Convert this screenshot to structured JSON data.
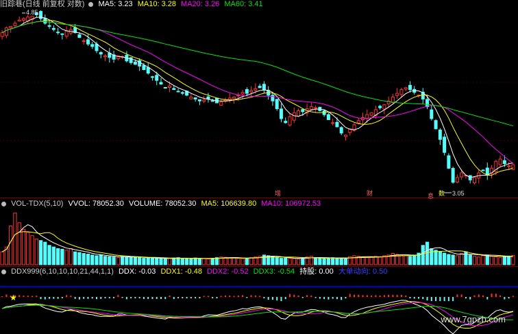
{
  "colors": {
    "up": "#ff3232",
    "down": "#54fcfc",
    "ma5": "#ffffff",
    "ma10": "#ffff00",
    "ma20": "#ff00ff",
    "ma60": "#00e600",
    "blue_line": "#0000ff",
    "separator": "#7a0000"
  },
  "price_panel": {
    "title": "旧踪巷(日线 前复权 对数)",
    "gear_icon": "gear-icon",
    "ma5": "MA5: 3.23",
    "ma10": "MA10: 3.28",
    "ma20": "MA20: 3.26",
    "ma60": "MA60: 3.41",
    "high_label": "4.85",
    "low_label": "3.05",
    "events": [
      {
        "text": "增",
        "color": "#ff6464"
      },
      {
        "text": "财",
        "color": "#ff6464"
      },
      {
        "text": "息",
        "color": "#ff6464"
      },
      {
        "text": "数",
        "color": "#ffff00"
      }
    ]
  },
  "vol_panel": {
    "name": "VOL-TDX(5,10)",
    "vvol": "VVOL: 78052.30",
    "volume": "VOLUME: 78052.30",
    "ma5": "MA5: 106639.80",
    "ma10": "MA10: 106972.53"
  },
  "ddx_panel": {
    "name": "DDX999(6,10,10,10,21,44,1,1)",
    "ddx": "DDX: -0.03",
    "ddx1": "DDX1: -0.48",
    "ddx2": "DDX2: -0.52",
    "ddx3": "DDX3: -0.54",
    "hold": "持股: 0.00",
    "big": "大单动向: 0.50"
  },
  "watermark": "www.7gpzb.com",
  "chart_data": {
    "type": "candlestick",
    "title": "旧踪巷(日线 前复权 对数)",
    "points": 120,
    "close": [
      4.62,
      4.68,
      4.7,
      4.74,
      4.78,
      4.8,
      4.82,
      4.83,
      4.85,
      4.8,
      4.74,
      4.7,
      4.66,
      4.62,
      4.6,
      4.64,
      4.66,
      4.62,
      4.56,
      4.52,
      4.48,
      4.45,
      4.4,
      4.36,
      4.34,
      4.32,
      4.3,
      4.34,
      4.33,
      4.28,
      4.26,
      4.24,
      4.22,
      4.18,
      4.14,
      4.1,
      4.06,
      4.02,
      3.98,
      4.0,
      3.96,
      3.94,
      3.92,
      3.9,
      3.88,
      3.86,
      3.84,
      3.85,
      3.86,
      3.84,
      3.82,
      3.83,
      3.85,
      3.87,
      3.88,
      3.9,
      3.93,
      3.92,
      3.95,
      3.97,
      3.98,
      3.96,
      3.9,
      3.84,
      3.76,
      3.66,
      3.62,
      3.68,
      3.72,
      3.74,
      3.73,
      3.76,
      3.78,
      3.77,
      3.74,
      3.7,
      3.65,
      3.62,
      3.58,
      3.52,
      3.5,
      3.56,
      3.6,
      3.64,
      3.67,
      3.7,
      3.72,
      3.75,
      3.77,
      3.8,
      3.84,
      3.88,
      3.92,
      3.96,
      3.98,
      3.96,
      3.93,
      3.9,
      3.86,
      3.78,
      3.66,
      3.56,
      3.46,
      3.34,
      3.2,
      3.08,
      3.12,
      3.16,
      3.14,
      3.1,
      3.12,
      3.16,
      3.18,
      3.14,
      3.2,
      3.26,
      3.28,
      3.24,
      3.22,
      3.23
    ],
    "volume": [
      40,
      55,
      120,
      160,
      130,
      110,
      100,
      90,
      80,
      75,
      70,
      60,
      55,
      50,
      48,
      45,
      50,
      40,
      38,
      35,
      33,
      30,
      28,
      30,
      26,
      25,
      24,
      22,
      26,
      25,
      24,
      23,
      22,
      20,
      21,
      22,
      20,
      19,
      18,
      20,
      21,
      22,
      20,
      19,
      18,
      21,
      20,
      19,
      18,
      20,
      22,
      24,
      23,
      21,
      22,
      20,
      19,
      20,
      22,
      24,
      26,
      30,
      28,
      25,
      22,
      20,
      21,
      20,
      19,
      18,
      20,
      24,
      26,
      22,
      20,
      19,
      21,
      22,
      20,
      18,
      20,
      25,
      28,
      26,
      24,
      22,
      24,
      26,
      25,
      28,
      30,
      35,
      32,
      30,
      28,
      26,
      30,
      36,
      60,
      70,
      50,
      45,
      40,
      36,
      32,
      30,
      28,
      35,
      40,
      30,
      26,
      24,
      28,
      30,
      26,
      24,
      22,
      25,
      27,
      29
    ],
    "ylim": [
      3.0,
      4.9
    ]
  }
}
